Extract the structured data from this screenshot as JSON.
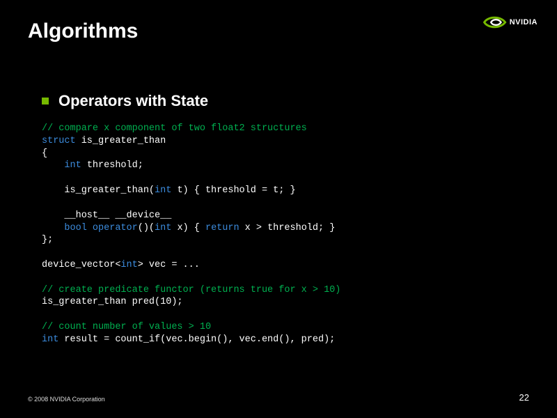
{
  "title": "Algorithms",
  "logo_text": "NVIDIA",
  "subtitle": "Operators with State",
  "code": {
    "l1": "// compare x component of two float2 structures",
    "l2a": "struct",
    "l2b": " is_greater_than",
    "l3": "{",
    "l4a": "    ",
    "l4b": "int",
    "l4c": " threshold;",
    "l5": "",
    "l6a": "    is_greater_than(",
    "l6b": "int",
    "l6c": " t) { threshold = t; }",
    "l7": "",
    "l8": "    __host__ __device__",
    "l9a": "    ",
    "l9b": "bool",
    "l9c": " ",
    "l9d": "operator",
    "l9e": "()(",
    "l9f": "int",
    "l9g": " x) { ",
    "l9h": "return",
    "l9i": " x > threshold; }",
    "l10": "};",
    "l11": "",
    "l12a": "device_vector<",
    "l12b": "int",
    "l12c": "> vec = ...",
    "l13": "",
    "l14": "// create predicate functor (returns true for x > 10)",
    "l15": "is_greater_than pred(10);",
    "l16": "",
    "l17": "// count number of values > 10",
    "l18a": "int",
    "l18b": " result = count_if(vec.begin(), vec.end(), pred);"
  },
  "footer": "© 2008 NVIDIA Corporation",
  "page_number": "22"
}
